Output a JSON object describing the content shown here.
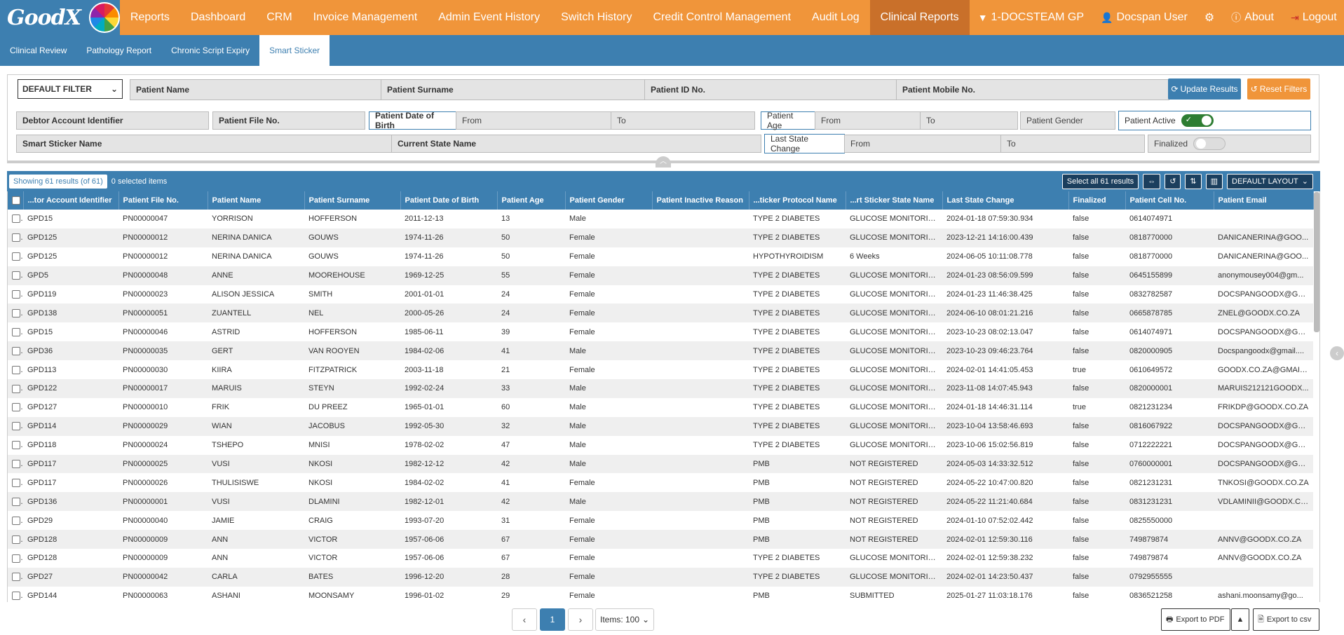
{
  "nav": {
    "logo_text": "GoodX",
    "items": [
      "Reports",
      "Dashboard",
      "CRM",
      "Invoice Management",
      "Admin Event History",
      "Switch History",
      "Credit Control Management",
      "Audit Log",
      "Clinical Reports"
    ],
    "practice": "1-DOCSTEAM GP",
    "user": "Docspan User",
    "about": "About",
    "logout": "Logout"
  },
  "subnav": {
    "items": [
      "Clinical Review",
      "Pathology Report",
      "Chronic Script Expiry",
      "Smart Sticker"
    ]
  },
  "filters": {
    "default_filter": "DEFAULT FILTER",
    "patient_name": "Patient Name",
    "patient_surname": "Patient Surname",
    "patient_id": "Patient ID No.",
    "patient_mobile": "Patient Mobile No.",
    "update": "Update Results",
    "reset": "Reset Filters",
    "debtor_account": "Debtor Account Identifier",
    "patient_file": "Patient File No.",
    "dob": "Patient Date of Birth",
    "from": "From",
    "to": "To",
    "age": "Patient Age",
    "gender": "Patient Gender",
    "active": "Patient Active",
    "smart_sticker_name": "Smart Sticker Name",
    "current_state": "Current State Name",
    "last_state_change": "Last State Change",
    "finalized": "Finalized"
  },
  "results": {
    "showing": "Showing 61 results (of 61)",
    "selected": "0 selected items",
    "select_all": "Select all 61 results",
    "layout": "DEFAULT LAYOUT"
  },
  "table": {
    "columns": [
      "...tor Account Identifier",
      "Patient File No.",
      "Patient Name",
      "Patient Surname",
      "Patient Date of Birth",
      "Patient Age",
      "Patient Gender",
      "Patient Inactive Reason",
      "...ticker Protocol Name",
      "...rt Sticker State Name",
      "Last State Change",
      "Finalized",
      "Patient Cell No.",
      "Patient Email"
    ],
    "rows": [
      [
        "GPD15",
        "PN00000047",
        "YORRISON",
        "HOFFERSON",
        "2011-12-13",
        "13",
        "Male",
        "",
        "TYPE 2 DIABETES",
        "GLUCOSE MONITORING",
        "2024-01-18 07:59:30.934",
        "false",
        "0614074971",
        ""
      ],
      [
        "GPD125",
        "PN00000012",
        "NERINA DANICA",
        "GOUWS",
        "1974-11-26",
        "50",
        "Female",
        "",
        "TYPE 2 DIABETES",
        "GLUCOSE MONITORING",
        "2023-12-21 14:16:00.439",
        "false",
        "0818770000",
        "DANICANERINA@GOO..."
      ],
      [
        "GPD125",
        "PN00000012",
        "NERINA DANICA",
        "GOUWS",
        "1974-11-26",
        "50",
        "Female",
        "",
        "HYPOTHYROIDISM",
        "6 Weeks",
        "2024-06-05 10:11:08.778",
        "false",
        "0818770000",
        "DANICANERINA@GOO..."
      ],
      [
        "GPD5",
        "PN00000048",
        "ANNE",
        "MOOREHOUSE",
        "1969-12-25",
        "55",
        "Female",
        "",
        "TYPE 2 DIABETES",
        "GLUCOSE MONITORING",
        "2024-01-23 08:56:09.599",
        "false",
        "0645155899",
        "anonymousey004@gm..."
      ],
      [
        "GPD119",
        "PN00000023",
        "ALISON JESSICA",
        "SMITH",
        "2001-01-01",
        "24",
        "Female",
        "",
        "TYPE 2 DIABETES",
        "GLUCOSE MONITORING",
        "2024-01-23 11:46:38.425",
        "false",
        "0832782587",
        "DOCSPANGOODX@GM..."
      ],
      [
        "GPD138",
        "PN00000051",
        "ZUANTELL",
        "NEL",
        "2000-05-26",
        "24",
        "Female",
        "",
        "TYPE 2 DIABETES",
        "GLUCOSE MONITORING",
        "2024-06-10 08:01:21.216",
        "false",
        "0665878785",
        "ZNEL@GOODX.CO.ZA"
      ],
      [
        "GPD15",
        "PN00000046",
        "ASTRID",
        "HOFFERSON",
        "1985-06-11",
        "39",
        "Female",
        "",
        "TYPE 2 DIABETES",
        "GLUCOSE MONITORING",
        "2023-10-23 08:02:13.047",
        "false",
        "0614074971",
        "DOCSPANGOODX@GM..."
      ],
      [
        "GPD36",
        "PN00000035",
        "GERT",
        "VAN ROOYEN",
        "1984-02-06",
        "41",
        "Male",
        "",
        "TYPE 2 DIABETES",
        "GLUCOSE MONITORING",
        "2023-10-23 09:46:23.764",
        "false",
        "0820000905",
        "Docspangoodx@gmail...."
      ],
      [
        "GPD113",
        "PN00000030",
        "KIIRA",
        "FITZPATRICK",
        "2003-11-18",
        "21",
        "Female",
        "",
        "TYPE 2 DIABETES",
        "GLUCOSE MONITORING",
        "2024-02-01 14:41:05.453",
        "true",
        "0610649572",
        "GOODX.CO.ZA@GMAIL...."
      ],
      [
        "GPD122",
        "PN00000017",
        "MARUIS",
        "STEYN",
        "1992-02-24",
        "33",
        "Male",
        "",
        "TYPE 2 DIABETES",
        "GLUCOSE MONITORING",
        "2023-11-08 14:07:45.943",
        "false",
        "0820000001",
        "MARUIS212121GOODX..."
      ],
      [
        "GPD127",
        "PN00000010",
        "FRIK",
        "DU PREEZ",
        "1965-01-01",
        "60",
        "Male",
        "",
        "TYPE 2 DIABETES",
        "GLUCOSE MONITORING",
        "2024-01-18 14:46:31.114",
        "true",
        "0821231234",
        "FRIKDP@GOODX.CO.ZA"
      ],
      [
        "GPD114",
        "PN00000029",
        "WIAN",
        "JACOBUS",
        "1992-05-30",
        "32",
        "Male",
        "",
        "TYPE 2 DIABETES",
        "GLUCOSE MONITORING",
        "2023-10-04 13:58:46.693",
        "false",
        "0816067922",
        "DOCSPANGOODX@GM..."
      ],
      [
        "GPD118",
        "PN00000024",
        "TSHEPO",
        "MNISI",
        "1978-02-02",
        "47",
        "Male",
        "",
        "TYPE 2 DIABETES",
        "GLUCOSE MONITORING",
        "2023-10-06 15:02:56.819",
        "false",
        "0712222221",
        "DOCSPANGOODX@GM..."
      ],
      [
        "GPD117",
        "PN00000025",
        "VUSI",
        "NKOSI",
        "1982-12-12",
        "42",
        "Male",
        "",
        "PMB",
        "NOT REGISTERED",
        "2024-05-03 14:33:32.512",
        "false",
        "0760000001",
        "DOCSPANGOODX@GM..."
      ],
      [
        "GPD117",
        "PN00000026",
        "THULISISWE",
        "NKOSI",
        "1984-02-02",
        "41",
        "Female",
        "",
        "PMB",
        "NOT REGISTERED",
        "2024-05-22 10:47:00.820",
        "false",
        "0821231231",
        "TNKOSI@GOODX.CO.ZA"
      ],
      [
        "GPD136",
        "PN00000001",
        "VUSI",
        "DLAMINI",
        "1982-12-01",
        "42",
        "Male",
        "",
        "PMB",
        "NOT REGISTERED",
        "2024-05-22 11:21:40.684",
        "false",
        "0831231231",
        "VDLAMINII@GOODX.CO..."
      ],
      [
        "GPD29",
        "PN00000040",
        "JAMIE",
        "CRAIG",
        "1993-07-20",
        "31",
        "Female",
        "",
        "PMB",
        "NOT REGISTERED",
        "2024-01-10 07:52:02.442",
        "false",
        "0825550000",
        ""
      ],
      [
        "GPD128",
        "PN00000009",
        "ANN",
        "VICTOR",
        "1957-06-06",
        "67",
        "Female",
        "",
        "PMB",
        "NOT REGISTERED",
        "2024-02-01 12:59:30.116",
        "false",
        "749879874",
        "ANNV@GOODX.CO.ZA"
      ],
      [
        "GPD128",
        "PN00000009",
        "ANN",
        "VICTOR",
        "1957-06-06",
        "67",
        "Female",
        "",
        "TYPE 2 DIABETES",
        "GLUCOSE MONITORING",
        "2024-02-01 12:59:38.232",
        "false",
        "749879874",
        "ANNV@GOODX.CO.ZA"
      ],
      [
        "GPD27",
        "PN00000042",
        "CARLA",
        "BATES",
        "1996-12-20",
        "28",
        "Female",
        "",
        "TYPE 2 DIABETES",
        "GLUCOSE MONITORING",
        "2024-02-01 14:23:50.437",
        "false",
        "0792955555",
        ""
      ],
      [
        "GPD144",
        "PN00000063",
        "ASHANI",
        "MOONSAMY",
        "1996-01-02",
        "29",
        "Female",
        "",
        "PMB",
        "SUBMITTED",
        "2025-01-27 11:03:18.176",
        "false",
        "0836521258",
        "ashani.moonsamy@go..."
      ]
    ]
  },
  "pagination": {
    "current": "1",
    "items": "Items: 100",
    "export_pdf": "Export to PDF",
    "export_csv": "Export to csv"
  },
  "colors": {
    "accent_blue": "#3d7fb0",
    "accent_orange": "#f0953a"
  }
}
